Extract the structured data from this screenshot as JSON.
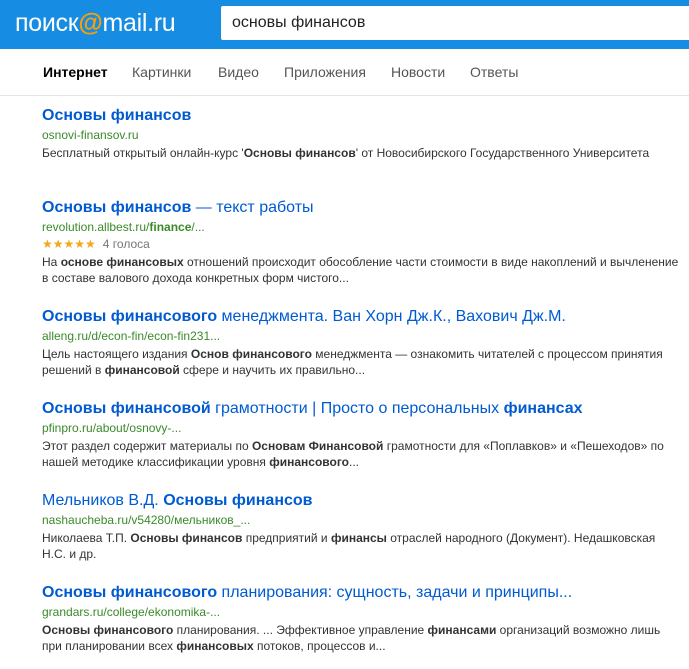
{
  "header": {
    "logo": {
      "part1": "поиск",
      "at": "@",
      "part2": "mail",
      "dot": ".ru"
    },
    "query": "основы финансов"
  },
  "tabs": [
    {
      "label": "Интернет",
      "active": true
    },
    {
      "label": "Картинки"
    },
    {
      "label": "Видео"
    },
    {
      "label": "Приложения"
    },
    {
      "label": "Новости"
    },
    {
      "label": "Ответы"
    }
  ],
  "results": [
    {
      "title": [
        {
          "t": "Основы финансов",
          "b": true
        }
      ],
      "url": [
        {
          "t": "osnovi-finansov.ru"
        }
      ],
      "snippet": [
        {
          "t": "Бесплатный открытый онлайн-курс '"
        },
        {
          "t": "Основы финансов",
          "b": true
        },
        {
          "t": "' от Новосибирского Государственного Университета"
        }
      ]
    },
    {
      "title": [
        {
          "t": "Основы финансов",
          "b": true
        },
        {
          "t": " — текст работы"
        }
      ],
      "url": [
        {
          "t": "revolution.allbest.ru/"
        },
        {
          "t": "finance",
          "b": true
        },
        {
          "t": "/..."
        }
      ],
      "rating": {
        "stars": "★★★★★",
        "value": 4.5,
        "votes": "4 голоса"
      },
      "snippet": [
        {
          "t": "На "
        },
        {
          "t": "основе финансовых",
          "b": true
        },
        {
          "t": " отношений происходит обособление части стоимости в виде накоплений и вычленение в составе валового дохода конкретных форм чистого..."
        }
      ]
    },
    {
      "title": [
        {
          "t": "Основы финансового",
          "b": true
        },
        {
          "t": " менеджмента. Ван Хорн Дж.К., Вахович Дж.М."
        }
      ],
      "url": [
        {
          "t": "alleng.ru/d/econ-fin/econ-fin231..."
        }
      ],
      "snippet": [
        {
          "t": "Цель настоящего издания "
        },
        {
          "t": "Основ финансового",
          "b": true
        },
        {
          "t": " менеджмента — ознакомить читателей с процессом принятия решений в "
        },
        {
          "t": "финансовой",
          "b": true
        },
        {
          "t": " сфере и научить их правильно..."
        }
      ]
    },
    {
      "title": [
        {
          "t": "Основы финансовой",
          "b": true
        },
        {
          "t": " грамотности | Просто о персональных "
        },
        {
          "t": "финансах",
          "b": true
        }
      ],
      "url": [
        {
          "t": "pfinpro.ru/about/osnovy-..."
        }
      ],
      "snippet": [
        {
          "t": "Этот раздел содержит материалы по "
        },
        {
          "t": "Основам Финансовой",
          "b": true
        },
        {
          "t": " грамотности для «Поплавков» и «Пешеходов» по нашей методике классификации уровня "
        },
        {
          "t": "финансового",
          "b": true
        },
        {
          "t": "..."
        }
      ]
    },
    {
      "title": [
        {
          "t": "Мельников В.Д. "
        },
        {
          "t": "Основы финансов",
          "b": true
        }
      ],
      "url": [
        {
          "t": "nashaucheba.ru/v54280/мельников_..."
        }
      ],
      "snippet": [
        {
          "t": "Николаева Т.П. "
        },
        {
          "t": "Основы финансов",
          "b": true
        },
        {
          "t": " предприятий и "
        },
        {
          "t": "финансы",
          "b": true
        },
        {
          "t": " отраслей народного (Документ). Недашковская Н.С. и др."
        }
      ]
    },
    {
      "title": [
        {
          "t": "Основы финансового",
          "b": true
        },
        {
          "t": " планирования: сущность, задачи и принципы..."
        }
      ],
      "url": [
        {
          "t": "grandars.ru/college/ekonomika-..."
        }
      ],
      "snippet": [
        {
          "t": "Основы финансового",
          "b": true
        },
        {
          "t": " планирования. ... Эффективное управление "
        },
        {
          "t": "финансами",
          "b": true
        },
        {
          "t": " организаций возможно лишь при планировании всех "
        },
        {
          "t": "финансовых",
          "b": true
        },
        {
          "t": " потоков, процессов и..."
        }
      ]
    }
  ],
  "colors": {
    "topbar": "#168de2",
    "logo_at": "#ff9e00",
    "link": "#005bd1",
    "url": "#3a8a2a",
    "stars": "#f2a818"
  }
}
